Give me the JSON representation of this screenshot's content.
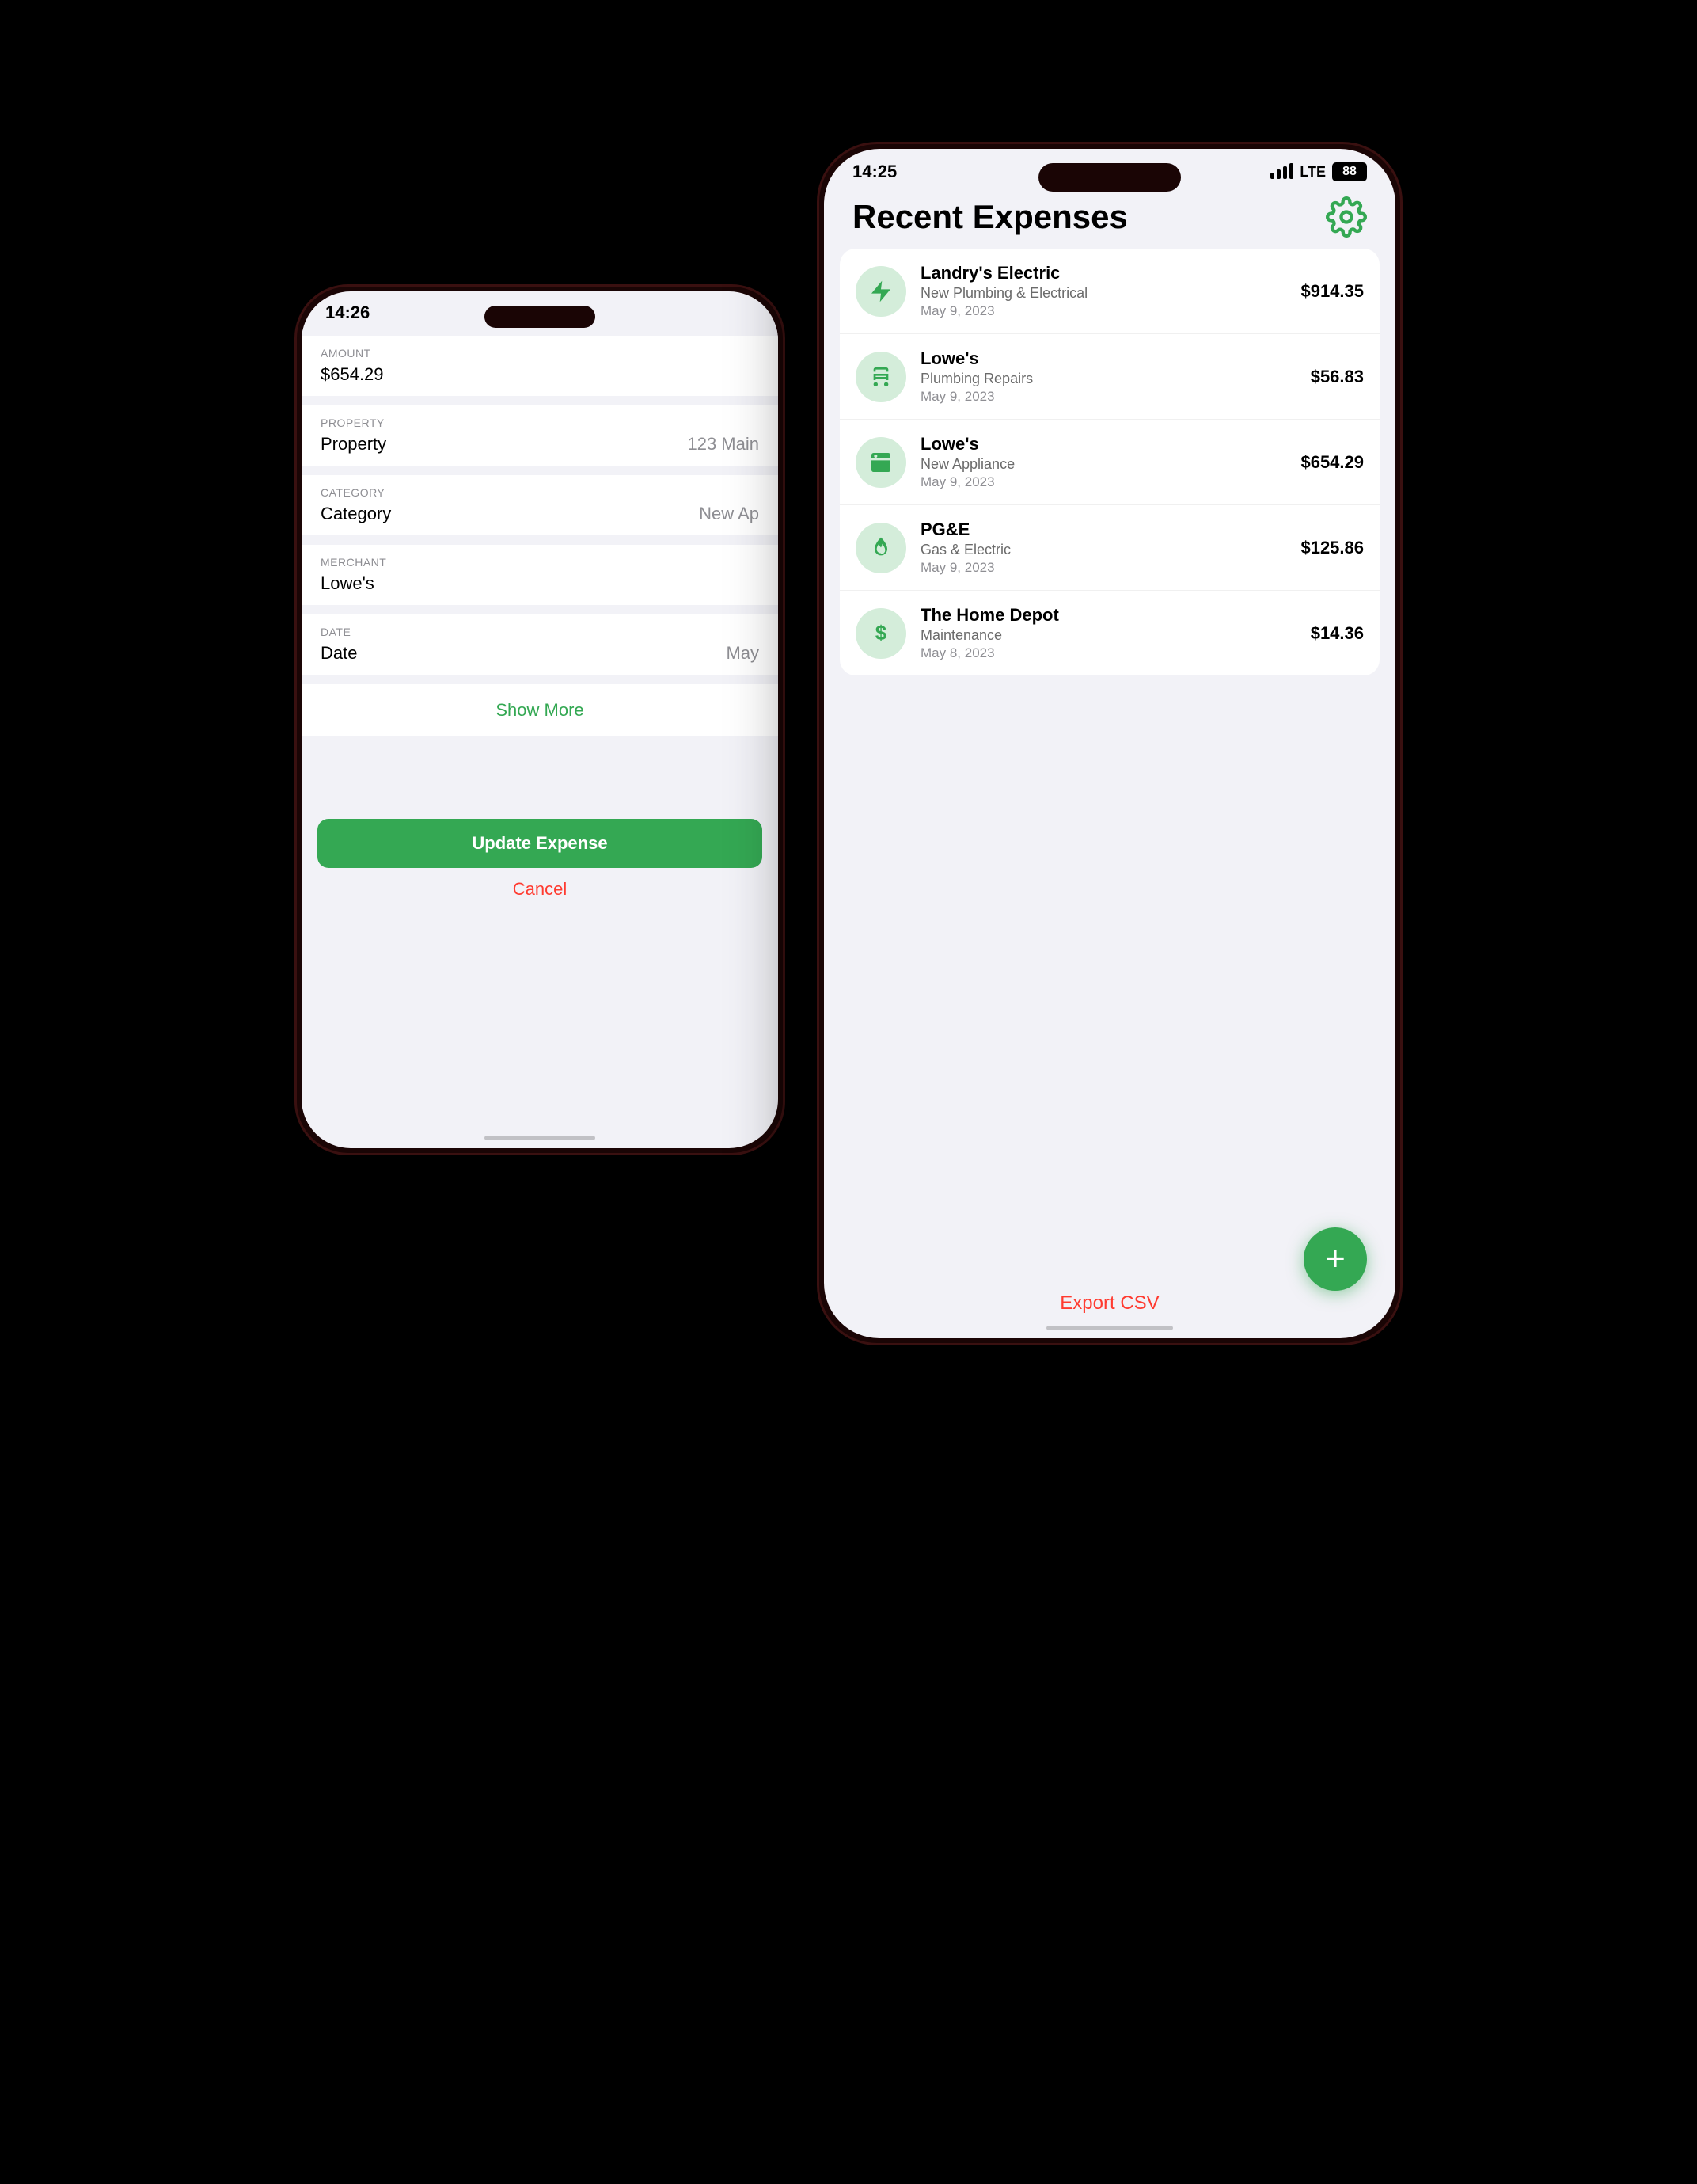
{
  "back_phone": {
    "time": "14:26",
    "fields": [
      {
        "label": "AMOUNT",
        "value": "$654.29",
        "value_right": ""
      },
      {
        "label": "PROPERTY",
        "value": "Property",
        "value_right": "123 Main"
      },
      {
        "label": "CATEGORY",
        "value": "Category",
        "value_right": "New Ap"
      },
      {
        "label": "MERCHANT",
        "value": "Lowe's",
        "value_right": ""
      },
      {
        "label": "DATE",
        "value": "Date",
        "value_right": "May"
      }
    ],
    "show_more": "Show More",
    "update_button": "Update Expense",
    "cancel_label": "Cancel"
  },
  "front_phone": {
    "time": "14:25",
    "signal": "LTE",
    "battery": "88",
    "title": "Recent Expenses",
    "gear_icon": "gear-icon",
    "expenses": [
      {
        "name": "Landry's Electric",
        "category": "New Plumbing & Electrical",
        "date": "May 9, 2023",
        "amount": "$914.35",
        "icon": "⚡",
        "icon_type": "electric"
      },
      {
        "name": "Lowe's",
        "category": "Plumbing Repairs",
        "date": "May 9, 2023",
        "amount": "$56.83",
        "icon": "🚿",
        "icon_type": "plumbing"
      },
      {
        "name": "Lowe's",
        "category": "New Appliance",
        "date": "May 9, 2023",
        "amount": "$654.29",
        "icon": "🖨",
        "icon_type": "appliance"
      },
      {
        "name": "PG&E",
        "category": "Gas & Electric",
        "date": "May 9, 2023",
        "amount": "$125.86",
        "icon": "💧",
        "icon_type": "gas"
      },
      {
        "name": "The Home Depot",
        "category": "Maintenance",
        "date": "May 8, 2023",
        "amount": "$14.36",
        "icon": "$",
        "icon_type": "dollar"
      }
    ],
    "export_csv": "Export CSV",
    "add_button_icon": "+"
  }
}
